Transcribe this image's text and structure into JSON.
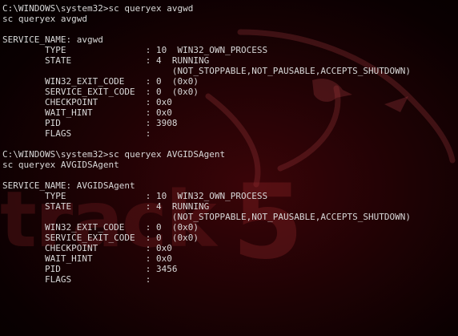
{
  "wallpaper": {
    "brand_text": "track",
    "brand_number": "5",
    "logo_icon": "dragon-icon",
    "background_color": "#1e0204",
    "text_color": "#d8d8d8"
  },
  "console": {
    "lines": [
      "C:\\WINDOWS\\system32>sc queryex avgwd",
      "sc queryex avgwd",
      "",
      "SERVICE_NAME: avgwd",
      "        TYPE               : 10  WIN32_OWN_PROCESS",
      "        STATE              : 4  RUNNING",
      "                                (NOT_STOPPABLE,NOT_PAUSABLE,ACCEPTS_SHUTDOWN)",
      "        WIN32_EXIT_CODE    : 0  (0x0)",
      "        SERVICE_EXIT_CODE  : 0  (0x0)",
      "        CHECKPOINT         : 0x0",
      "        WAIT_HINT          : 0x0",
      "        PID                : 3908",
      "        FLAGS              :",
      "",
      "C:\\WINDOWS\\system32>sc queryex AVGIDSAgent",
      "sc queryex AVGIDSAgent",
      "",
      "SERVICE_NAME: AVGIDSAgent",
      "        TYPE               : 10  WIN32_OWN_PROCESS",
      "        STATE              : 4  RUNNING",
      "                                (NOT_STOPPABLE,NOT_PAUSABLE,ACCEPTS_SHUTDOWN)",
      "        WIN32_EXIT_CODE    : 0  (0x0)",
      "        SERVICE_EXIT_CODE  : 0  (0x0)",
      "        CHECKPOINT         : 0x0",
      "        WAIT_HINT          : 0x0",
      "        PID                : 3456",
      "        FLAGS              :"
    ]
  }
}
